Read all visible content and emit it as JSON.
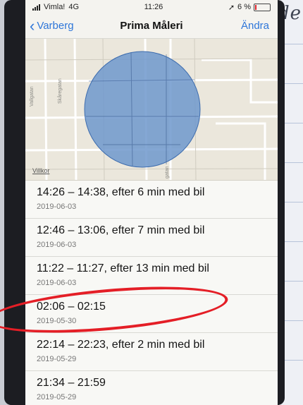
{
  "paper": {
    "scrawl": "nde"
  },
  "status_bar": {
    "carrier": "Vimla!",
    "network": "4G",
    "time": "11:26",
    "battery": "6 %",
    "battery_level": 0.06,
    "battery_color": "#e0242b"
  },
  "nav": {
    "back_label": "Varberg",
    "title": "Prima Måleri",
    "edit_label": "Ändra"
  },
  "map": {
    "legal_label": "Villkor",
    "street_labels": [
      "Vallgatan",
      "Skåregatan",
      "gatan"
    ],
    "region_fill": "#6f98cc"
  },
  "trips": [
    {
      "title": "14:26 – 14:38, efter 6 min med bil",
      "date": "2019-06-03"
    },
    {
      "title": "12:46 – 13:06, efter 7 min med bil",
      "date": "2019-06-03"
    },
    {
      "title": "11:22 – 11:27, efter 13 min med bil",
      "date": "2019-06-03"
    },
    {
      "title": "02:06 – 02:15",
      "date": "2019-05-30"
    },
    {
      "title": "22:14 – 22:23, efter 2 min med bil",
      "date": "2019-05-29"
    },
    {
      "title": "21:34 – 21:59",
      "date": "2019-05-29"
    }
  ],
  "annotation": {
    "circle_color": "#e41e26",
    "highlighted_row": 3
  }
}
